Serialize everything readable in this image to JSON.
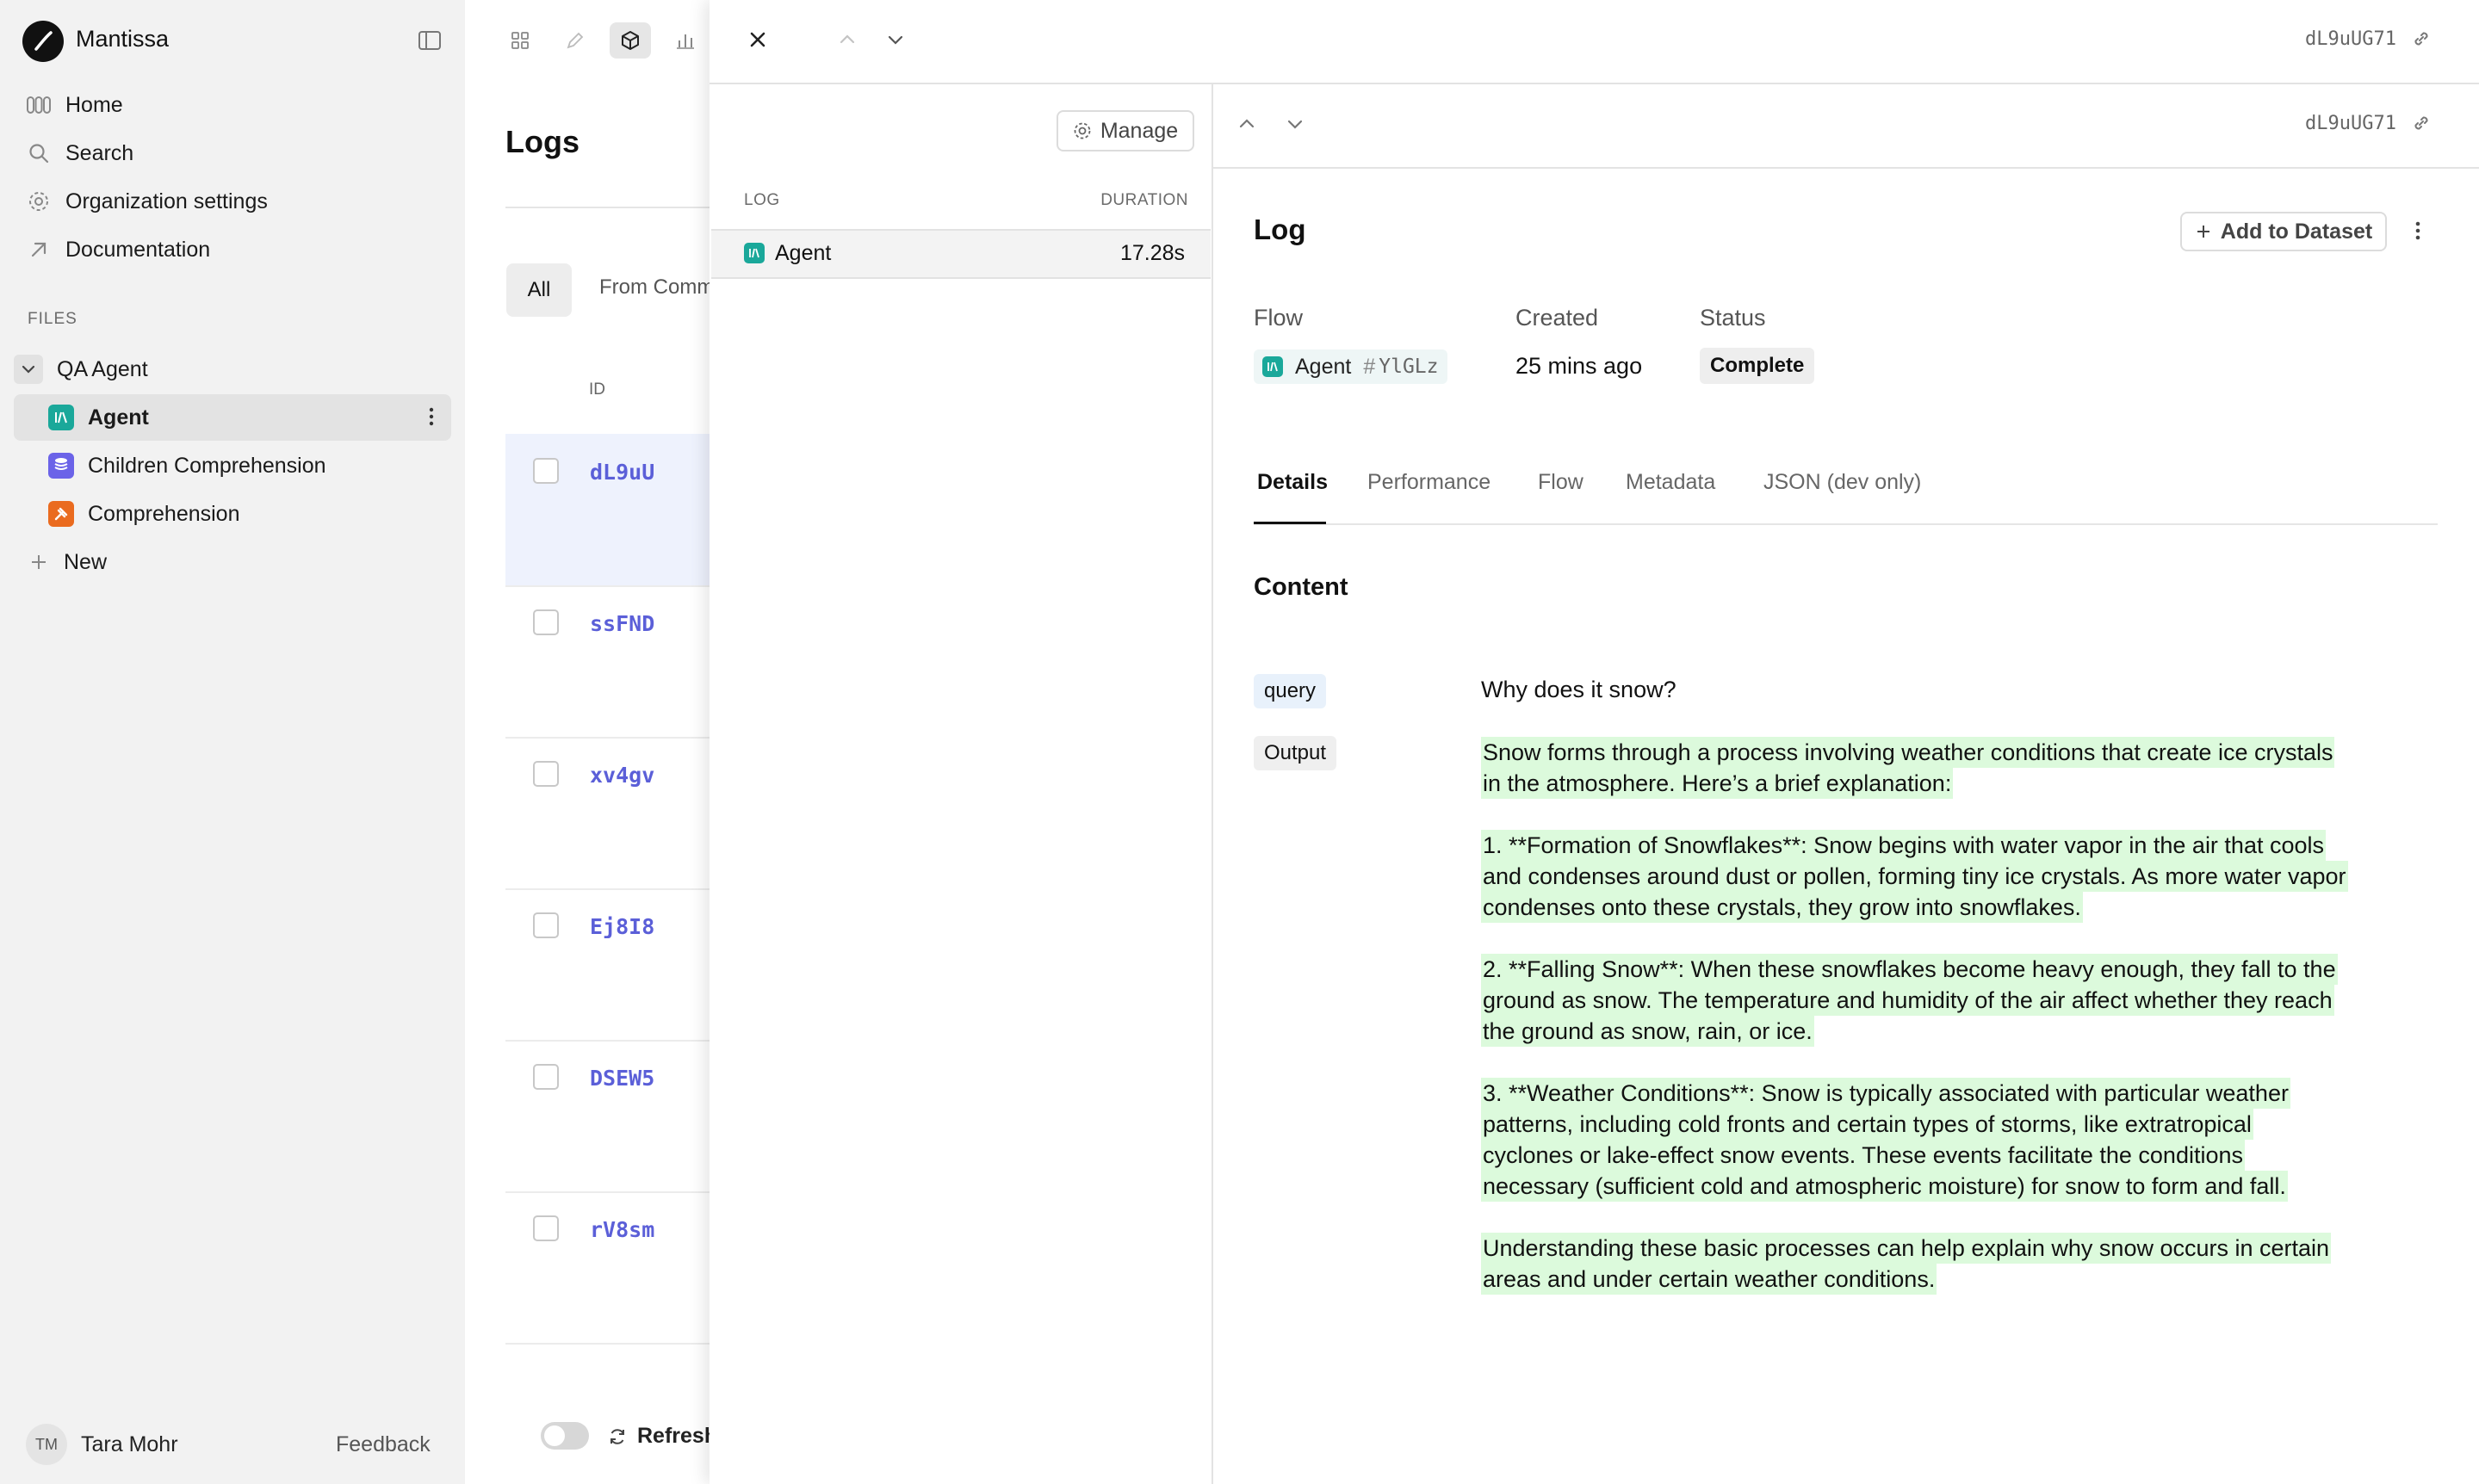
{
  "app": {
    "name": "Mantissa"
  },
  "sidebar": {
    "nav": [
      {
        "label": "Home",
        "icon": "home-icon"
      },
      {
        "label": "Search",
        "icon": "search-icon"
      },
      {
        "label": "Organization settings",
        "icon": "gear-icon"
      },
      {
        "label": "Documentation",
        "icon": "arrow-up-right-icon"
      }
    ],
    "files_label": "FILES",
    "tree": {
      "folder": "QA Agent",
      "items": [
        {
          "label": "Agent",
          "type": "agent",
          "color": "#1aa89a"
        },
        {
          "label": "Children Comprehension",
          "type": "dataset",
          "color": "#6b63e8"
        },
        {
          "label": "Comprehension",
          "type": "evaluator",
          "color": "#ea6b1f"
        }
      ],
      "new_label": "New"
    },
    "user": {
      "initials": "TM",
      "name": "Tara Mohr"
    },
    "feedback": "Feedback"
  },
  "logs": {
    "title": "Logs",
    "filters": {
      "all": "All",
      "from": "From Comm"
    },
    "col_id": "ID",
    "rows": [
      "dL9uU",
      "ssFND",
      "xv4gv",
      "Ej8I8",
      "DSEW5",
      "rV8sm"
    ],
    "refresh_label": "Refresh"
  },
  "drawer": {
    "log_id": "dL9uUG71",
    "manage_label": "Manage",
    "trace": {
      "col_log": "LOG",
      "col_duration": "DURATION",
      "row": {
        "name": "Agent",
        "duration": "17.28s"
      }
    },
    "detail": {
      "log_id": "dL9uUG71",
      "title": "Log",
      "add_to_dataset": "Add to Dataset",
      "meta": {
        "flow_label": "Flow",
        "flow_name": "Agent",
        "flow_hash": "#",
        "flow_version": "YlGLz",
        "created_label": "Created",
        "created_value": "25 mins ago",
        "status_label": "Status",
        "status_value": "Complete"
      },
      "tabs": [
        "Details",
        "Performance",
        "Flow",
        "Metadata",
        "JSON (dev only)"
      ],
      "content_heading": "Content",
      "query_key": "query",
      "query_value": "Why does it snow?",
      "output_key": "Output",
      "output_lines": [
        "Snow forms through a process involving weather conditions that create ice crystals",
        "in the atmosphere. Here’s a brief explanation:",
        "",
        "1. **Formation of Snowflakes**: Snow begins with water vapor in the air that cools",
        "and condenses around dust or pollen, forming tiny ice crystals. As more water vapor",
        "condenses onto these crystals, they grow into snowflakes.",
        "",
        "2. **Falling Snow**: When these snowflakes become heavy enough, they fall to the",
        "ground as snow. The temperature and humidity of the air affect whether they reach",
        "the ground as snow, rain, or ice.",
        "",
        "3. **Weather Conditions**: Snow is typically associated with particular weather",
        "patterns, including cold fronts and certain types of storms, like extratropical",
        "cyclones or lake-effect snow events. These events facilitate the conditions",
        "necessary (sufficient cold and atmospheric moisture) for snow to form and fall.",
        "",
        "Understanding these basic processes can help explain why snow occurs in certain",
        "areas and under certain weather conditions."
      ]
    }
  }
}
